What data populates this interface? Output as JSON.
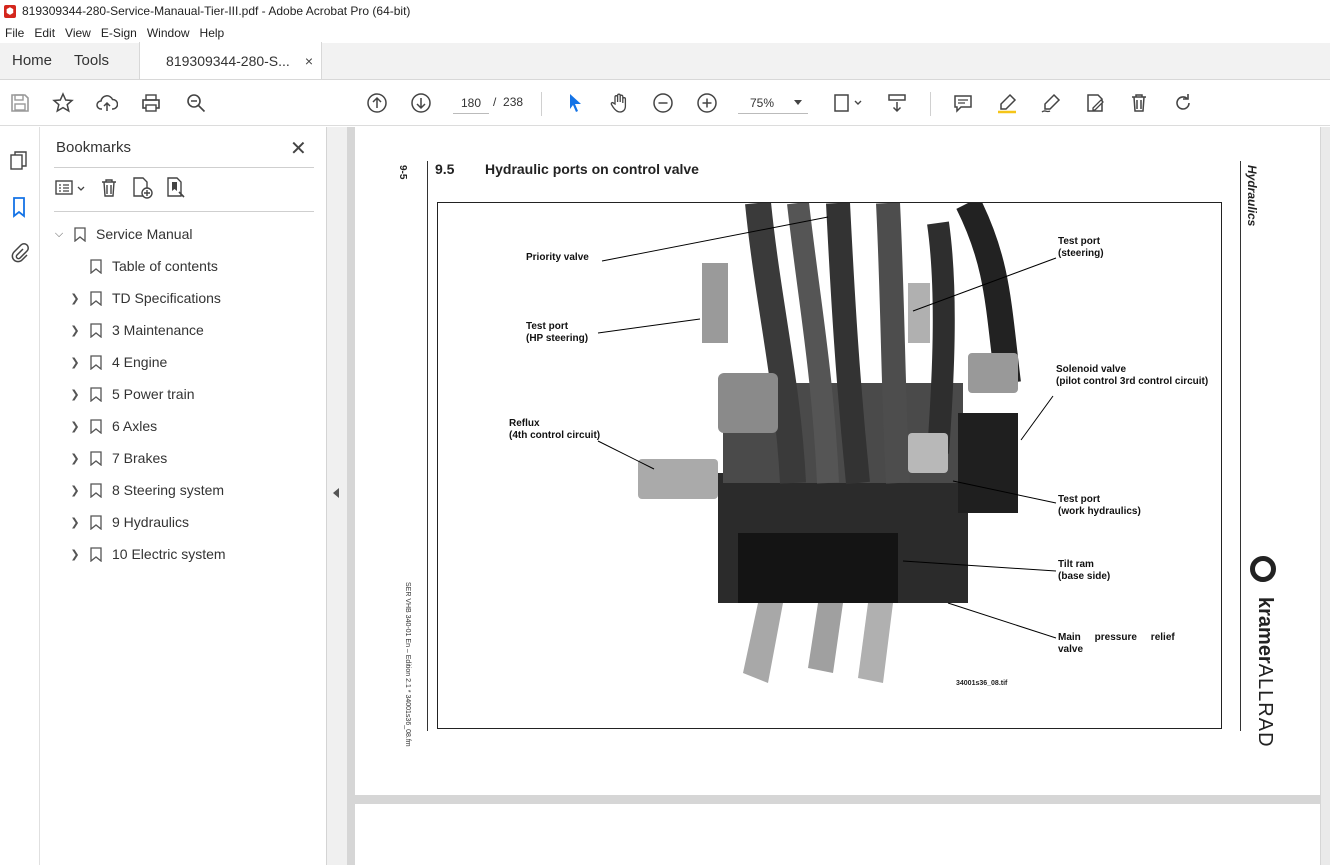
{
  "window": {
    "title": "819309344-280-Service-Manaual-Tier-III.pdf - Adobe Acrobat Pro (64-bit)"
  },
  "menu": [
    "File",
    "Edit",
    "View",
    "E-Sign",
    "Window",
    "Help"
  ],
  "tabs": {
    "home": "Home",
    "tools": "Tools",
    "document": "819309344-280-S...",
    "close": "×"
  },
  "toolbar": {
    "page_current": "180",
    "page_separator": "/",
    "page_total": "238",
    "zoom": "75%"
  },
  "bookmarks": {
    "title": "Bookmarks",
    "items": [
      {
        "label": "Service Manual",
        "expanded": true,
        "level": 0
      },
      {
        "label": "Table of contents",
        "level": 1,
        "has_children": false
      },
      {
        "label": "TD Specifications",
        "level": 1,
        "has_children": true
      },
      {
        "label": "3 Maintenance",
        "level": 1,
        "has_children": true
      },
      {
        "label": "4 Engine",
        "level": 1,
        "has_children": true
      },
      {
        "label": "5 Power train",
        "level": 1,
        "has_children": true
      },
      {
        "label": "6 Axles",
        "level": 1,
        "has_children": true
      },
      {
        "label": "7 Brakes",
        "level": 1,
        "has_children": true
      },
      {
        "label": "8 Steering system",
        "level": 1,
        "has_children": true
      },
      {
        "label": "9 Hydraulics",
        "level": 1,
        "has_children": true
      },
      {
        "label": "10 Electric system",
        "level": 1,
        "has_children": true
      }
    ]
  },
  "document_page": {
    "side_number": "9-5",
    "section_number": "9.5",
    "section_title": "Hydraulic ports on control valve",
    "chapter_side": "Hydraulics",
    "footer_side": "SER VHB 340-01 En – Edition 2.1 * 34001s36_08.fm",
    "brand_bold": "kramer",
    "brand_light": "ALLRAD",
    "figure_id": "34001s36_08.tif",
    "callouts": {
      "priority_valve": "Priority valve",
      "test_port_hp_1": "Test port",
      "test_port_hp_2": "(HP steering)",
      "reflux_1": "Reflux",
      "reflux_2": "(4th control circuit)",
      "test_port_steer_1": "Test port",
      "test_port_steer_2": "(steering)",
      "solenoid_1": "Solenoid valve",
      "solenoid_2": "(pilot control 3rd control circuit)",
      "test_port_work_1": "Test port",
      "test_port_work_2": "(work hydraulics)",
      "tilt_ram_1": "Tilt ram",
      "tilt_ram_2": "(base side)",
      "main_relief_1": "Main     pressure     relief",
      "main_relief_2": "valve"
    }
  }
}
